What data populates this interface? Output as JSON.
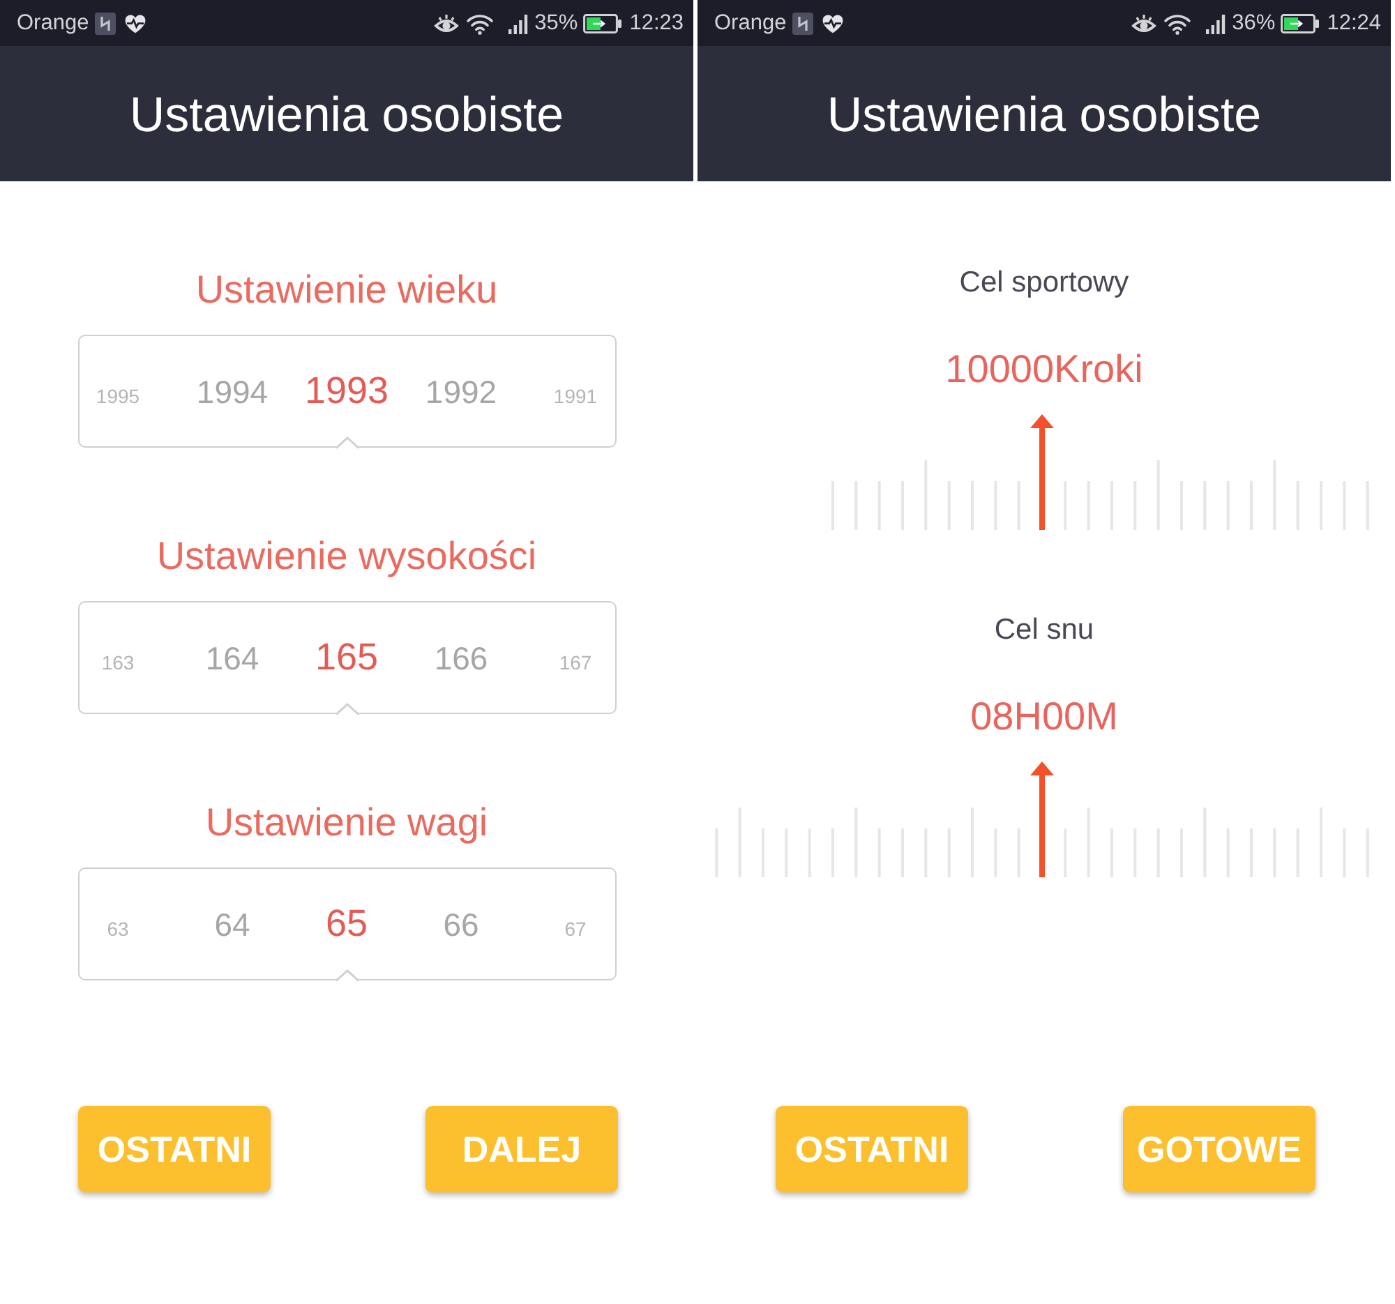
{
  "screens": [
    {
      "status_bar": {
        "carrier": "Orange",
        "battery": "35%",
        "time": "12:23"
      },
      "title": "Ustawienia osobiste",
      "kind": "pickers",
      "pickers": [
        {
          "label": "Ustawienie wieku",
          "values": [
            {
              "text": "1995",
              "selected": false
            },
            {
              "text": "1994",
              "selected": false
            },
            {
              "text": "1993",
              "selected": true
            },
            {
              "text": "1992",
              "selected": false
            },
            {
              "text": "1991",
              "selected": false
            }
          ]
        },
        {
          "label": "Ustawienie wysokości",
          "values": [
            {
              "text": "163",
              "selected": false
            },
            {
              "text": "164",
              "selected": false
            },
            {
              "text": "165",
              "selected": true
            },
            {
              "text": "166",
              "selected": false
            },
            {
              "text": "167",
              "selected": false
            }
          ]
        },
        {
          "label": "Ustawienie wagi",
          "values": [
            {
              "text": "63",
              "selected": false
            },
            {
              "text": "64",
              "selected": false
            },
            {
              "text": "65",
              "selected": true
            },
            {
              "text": "66",
              "selected": false
            },
            {
              "text": "67",
              "selected": false
            }
          ]
        }
      ],
      "buttons": [
        "OSTATNI",
        "DALEJ"
      ]
    },
    {
      "status_bar": {
        "carrier": "Orange",
        "battery": "36%",
        "time": "12:24"
      },
      "title": "Ustawienia osobiste",
      "kind": "rulers",
      "goals": [
        {
          "label": "Cel sportowy",
          "value": "10000Kroki"
        },
        {
          "label": "Cel snu",
          "value": "08H00M"
        }
      ],
      "buttons": [
        "OSTATNI",
        "GOTOWE"
      ]
    }
  ]
}
